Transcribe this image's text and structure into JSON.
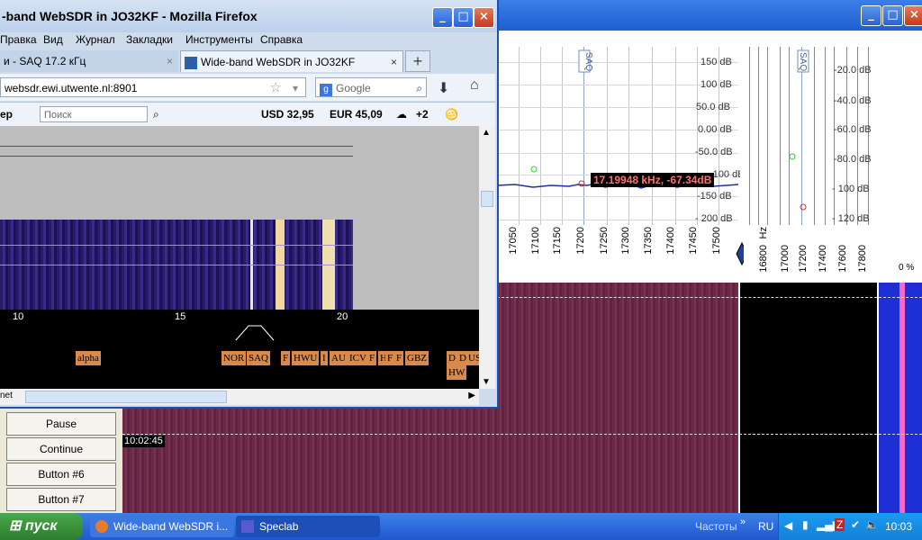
{
  "firefox": {
    "title": "-band WebSDR in JO32KF - Mozilla Firefox",
    "menu": [
      "Правка",
      "Вид",
      "Журнал",
      "Закладки",
      "Инструменты",
      "Справка"
    ],
    "tabs": [
      {
        "label": "и - SAQ 17.2 кГц",
        "close": "×"
      },
      {
        "label": "Wide-band WebSDR in JO32KF",
        "close": "×"
      }
    ],
    "new_tab": "+",
    "url": "websdr.ewi.utwente.nl:8901",
    "search_placeholder": "Google",
    "toolbar": {
      "left_label": "ер",
      "search_placeholder": "Поиск",
      "usd": "USD 32,95",
      "eur": "EUR 45,09",
      "weather": "+2"
    },
    "freq_labels": [
      "10",
      "15",
      "20"
    ],
    "channels": [
      "alpha",
      "NOR",
      "SAQ",
      "F",
      "HWU",
      "I",
      "AU",
      "ICV",
      "F",
      "H",
      "F",
      "F",
      "GBZ",
      "D",
      "D",
      "US",
      "HW"
    ],
    "status_left": "net"
  },
  "speclab": {
    "window_buttons": [
      "_",
      "□",
      "×"
    ],
    "y_labels_left": [
      "150 dB",
      "100 dB",
      "50.0 dB",
      "0.00 dB",
      "-50.0 dB",
      "-100 dB",
      "-150 dB",
      "- 200 dB"
    ],
    "y_labels_right": [
      "-20.0 dB",
      "-40.0 dB",
      "-60.0 dB",
      "-80.0 dB",
      "- 100 dB",
      "- 120 dB"
    ],
    "marker": "SAQ",
    "cursor_readout": "17.19948 kHz, -67.34dB",
    "x_ticks": [
      "17050",
      "17100",
      "17150",
      "17200",
      "17250",
      "17300",
      "17350",
      "17400",
      "17450",
      "17500"
    ],
    "x_ticks2": [
      "Hz",
      "16800",
      "17000",
      "17200",
      "17400",
      "17600",
      "17800"
    ],
    "right_scale": "0  %",
    "timestamp": "10:02:45",
    "buttons": [
      "Pause",
      "Continue",
      "Button #6",
      "Button #7"
    ]
  },
  "taskbar": {
    "start": "пуск",
    "tasks": [
      "Wide-band WebSDR i...",
      "Speclab"
    ],
    "tray_label": "Частоты",
    "lang": "RU",
    "clock": "10:03"
  }
}
